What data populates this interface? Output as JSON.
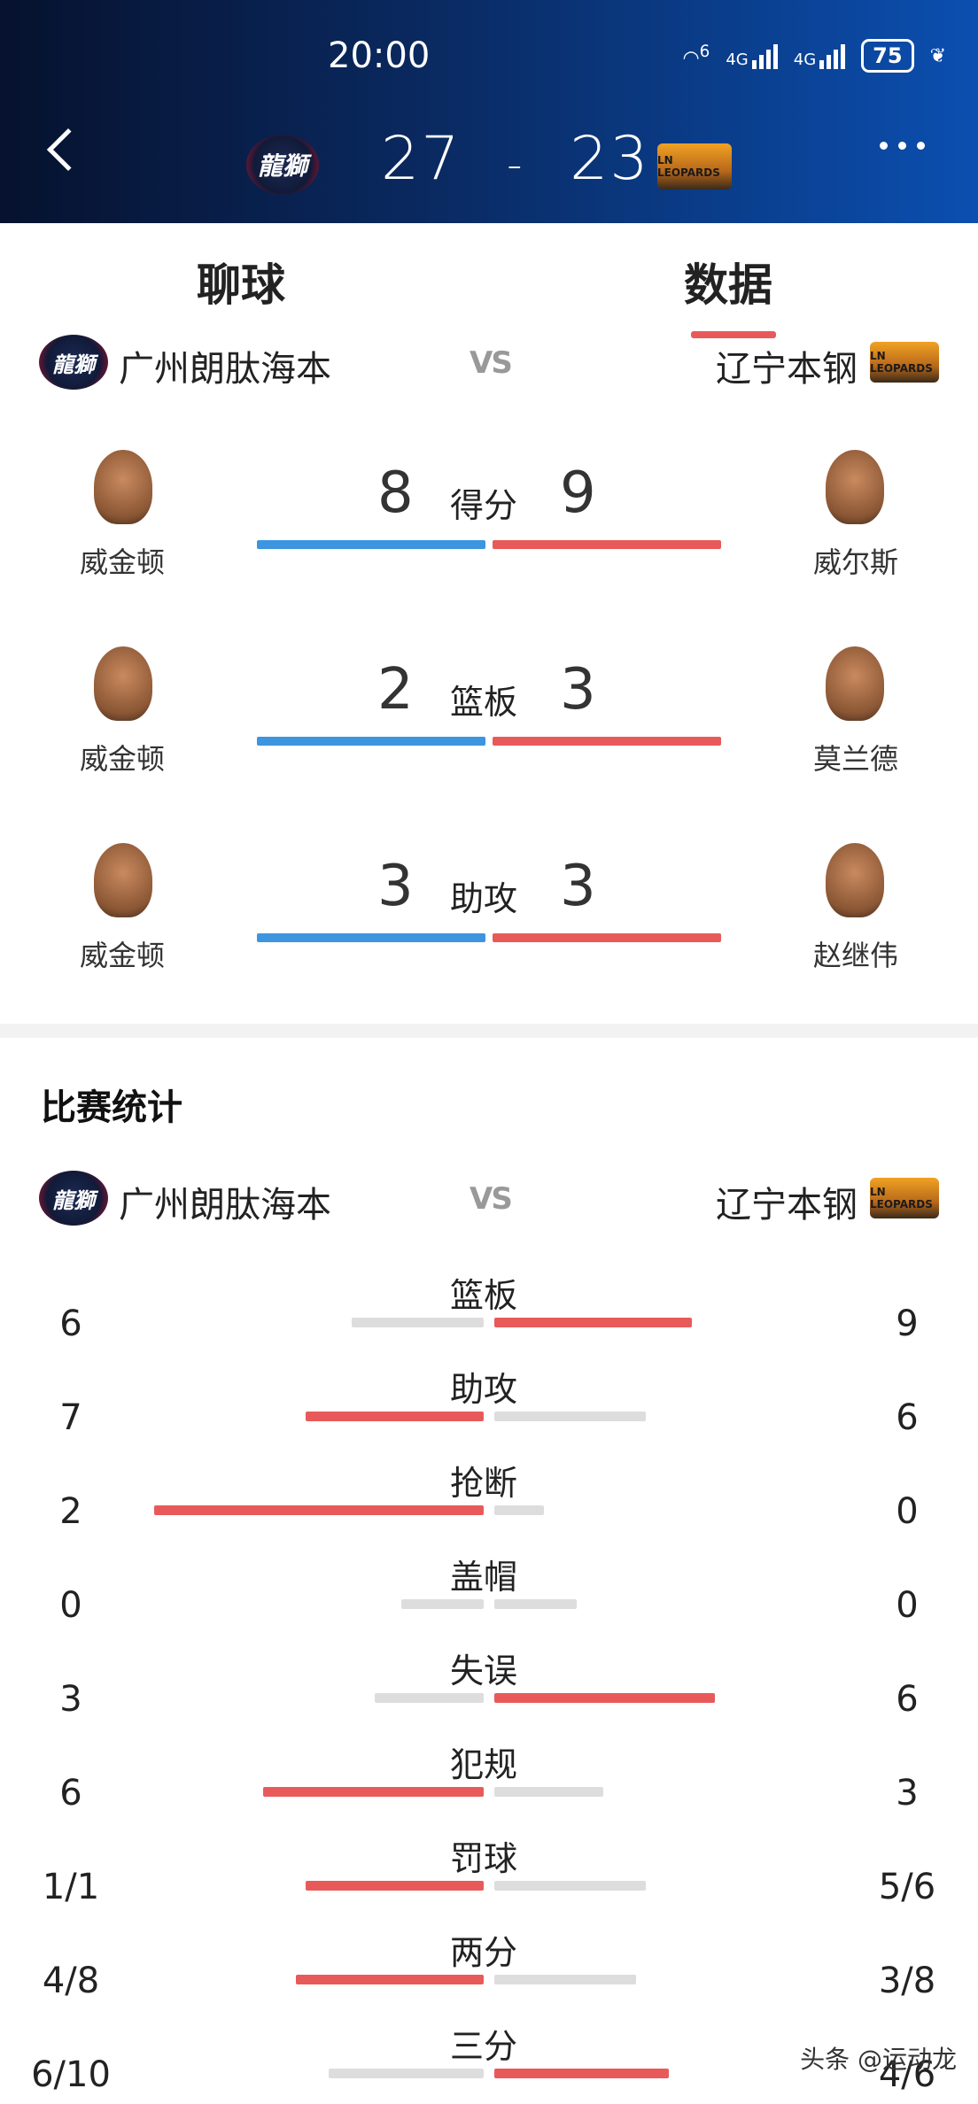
{
  "status_bar": {
    "time": "20:00",
    "wifi": "6",
    "net1": "4G",
    "net2": "4G",
    "battery": "75"
  },
  "header": {
    "home_team_logo_text": "龍獅",
    "away_team_logo_text": "LN LEOPARDS",
    "score_home": "27",
    "score_sep": "-",
    "score_away": "23"
  },
  "tabs": [
    {
      "label": "聊球"
    },
    {
      "label": "数据"
    }
  ],
  "teams": {
    "home": "广州朗肽海本",
    "vs": "VS",
    "away": "辽宁本钢"
  },
  "leaders": [
    {
      "category": "得分",
      "home_value": "8",
      "away_value": "9",
      "home_player": "威金顿",
      "away_player": "威尔斯"
    },
    {
      "category": "篮板",
      "home_value": "2",
      "away_value": "3",
      "home_player": "威金顿",
      "away_player": "莫兰德"
    },
    {
      "category": "助攻",
      "home_value": "3",
      "away_value": "3",
      "home_player": "威金顿",
      "away_player": "赵继伟"
    }
  ],
  "stats_section": {
    "title": "比赛统计"
  },
  "stats": [
    {
      "category": "篮板",
      "home": "6",
      "away": "9",
      "home_share": 0.4,
      "away_share": 0.6
    },
    {
      "category": "助攻",
      "home": "7",
      "away": "6",
      "home_share": 0.54,
      "away_share": 0.46
    },
    {
      "category": "抢断",
      "home": "2",
      "away": "0",
      "home_share": 1.0,
      "away_share": 0.15
    },
    {
      "category": "盖帽",
      "home": "0",
      "away": "0",
      "home_share": 0.25,
      "away_share": 0.25
    },
    {
      "category": "失误",
      "home": "3",
      "away": "6",
      "home_share": 0.33,
      "away_share": 0.67
    },
    {
      "category": "犯规",
      "home": "6",
      "away": "3",
      "home_share": 0.67,
      "away_share": 0.33
    },
    {
      "category": "罚球",
      "home": "1/1",
      "away": "5/6",
      "home_share": 0.54,
      "away_share": 0.46
    },
    {
      "category": "两分",
      "home": "4/8",
      "away": "3/8",
      "home_share": 0.57,
      "away_share": 0.43
    },
    {
      "category": "三分",
      "home": "6/10",
      "away": "4/6",
      "home_share": 0.47,
      "away_share": 0.53
    }
  ],
  "watermark": "头条 @运动龙",
  "colors": {
    "home_bar": "#3d95e0",
    "away_bar": "#e85a5a",
    "leading_bar": "#e85a5a",
    "trailing_bar": "#dddddd"
  }
}
